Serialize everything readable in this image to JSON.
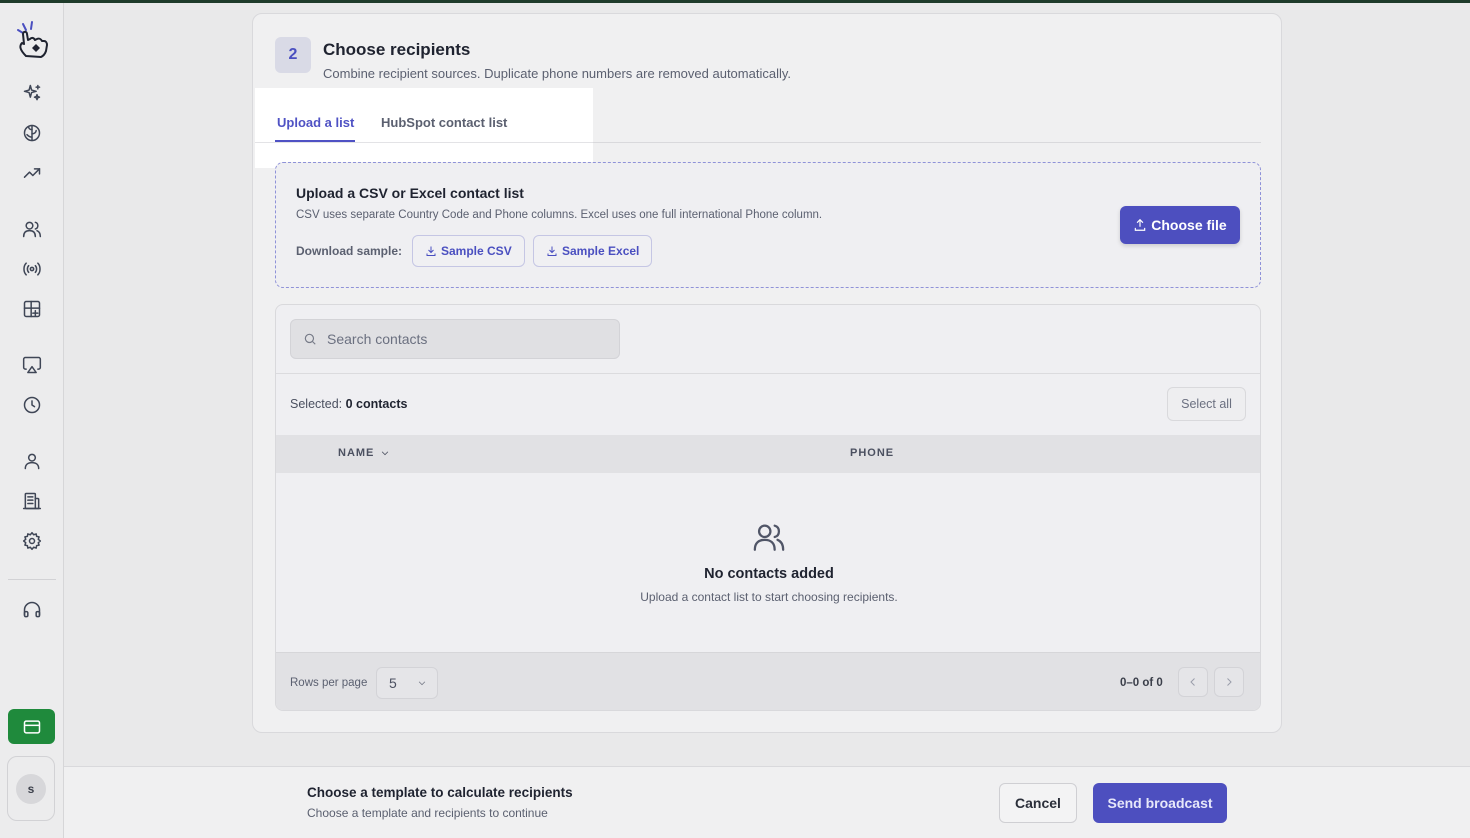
{
  "step": {
    "number": "2",
    "title": "Choose recipients",
    "subtitle": "Combine recipient sources. Duplicate phone numbers are removed automatically."
  },
  "tabs": [
    {
      "label": "Upload a list",
      "active": true
    },
    {
      "label": "HubSpot contact list",
      "active": false
    }
  ],
  "upload": {
    "title": "Upload a CSV or Excel contact list",
    "description": "CSV uses separate Country Code and Phone columns. Excel uses one full international Phone column.",
    "sample_label": "Download sample:",
    "sample_csv": "Sample CSV",
    "sample_excel": "Sample Excel",
    "choose_file": "Choose file"
  },
  "contacts": {
    "search_placeholder": "Search contacts",
    "selected_label": "Selected:",
    "selected_value": "0 contacts",
    "select_all": "Select all",
    "columns": [
      "NAME",
      "PHONE"
    ],
    "empty_title": "No contacts added",
    "empty_desc": "Upload a contact list to start choosing recipients.",
    "rows_per_page_label": "Rows per page",
    "rows_per_page_value": "5",
    "range": "0–0 of 0"
  },
  "sidebar": {
    "avatar_initial": "s",
    "icons": [
      "sparkles-icon",
      "brain-icon",
      "trending-icon",
      "users-icon",
      "broadcast-icon",
      "grid-plus-icon",
      "airplay-icon",
      "clock-icon",
      "user-icon",
      "building-icon",
      "gear-icon",
      "headphones-icon",
      "credit-card-icon"
    ]
  },
  "footer": {
    "title": "Choose a template to calculate recipients",
    "desc": "Choose a template and recipients to continue",
    "cancel": "Cancel",
    "send": "Send broadcast"
  },
  "colors": {
    "accent": "#4d4fbf",
    "billing": "#1f8a3c"
  }
}
